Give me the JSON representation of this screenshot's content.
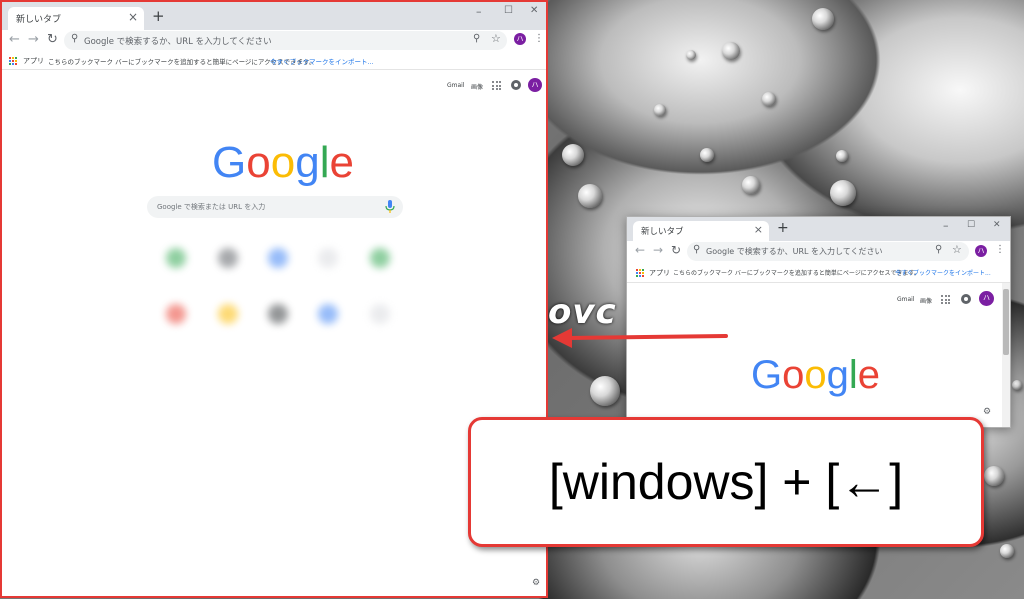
{
  "brand_colors": {
    "blue": "#4285f4",
    "red": "#ea4335",
    "yellow": "#fbbc05",
    "green": "#34a853",
    "highlight": "#e53935"
  },
  "left_window": {
    "tab_title": "新しいタブ",
    "tab_close": "×",
    "new_tab": "+",
    "omnibox_placeholder": "Google で検索するか、URL を入力してください",
    "bookmarks_apps": "アプリ",
    "bookmarks_message": "こちらのブックマーク バーにブックマークを追加すると簡単にページにアクセスできます。",
    "bookmarks_link": "今すぐブックマークをインポート...",
    "links": {
      "gmail": "Gmail",
      "images": "画像"
    },
    "avatar_letter": "ハ",
    "logo_letters": [
      "G",
      "o",
      "o",
      "g",
      "l",
      "e"
    ],
    "search_placeholder": "Google で検索または URL を入力",
    "window_controls": [
      "–",
      "☐",
      "✕"
    ]
  },
  "right_window": {
    "tab_title": "新しいタブ",
    "tab_close": "×",
    "new_tab": "+",
    "omnibox_placeholder": "Google で検索するか、URL を入力してください",
    "bookmarks_apps": "アプリ",
    "bookmarks_message": "こちらのブックマーク バーにブックマークを追加すると簡単にページにアクセスできます。",
    "bookmarks_link": "今すぐブックマークをインポート...",
    "links": {
      "gmail": "Gmail",
      "images": "画像"
    },
    "avatar_letter": "ハ",
    "logo_letters": [
      "G",
      "o",
      "o",
      "g",
      "l",
      "e"
    ],
    "window_controls": [
      "–",
      "☐",
      "✕"
    ]
  },
  "icons": {
    "back": "arrow-back-icon",
    "forward": "arrow-forward-icon",
    "reload": "reload-icon",
    "search": "search-icon",
    "zoom": "zoom-icon",
    "star": "star-icon",
    "menu": "menu-kebab-icon",
    "apps": "apps-grid-icon",
    "mic": "mic-icon",
    "settings": "gear-icon"
  },
  "desktop_partial_text": "ovc",
  "caption": "[windows] + [←]"
}
